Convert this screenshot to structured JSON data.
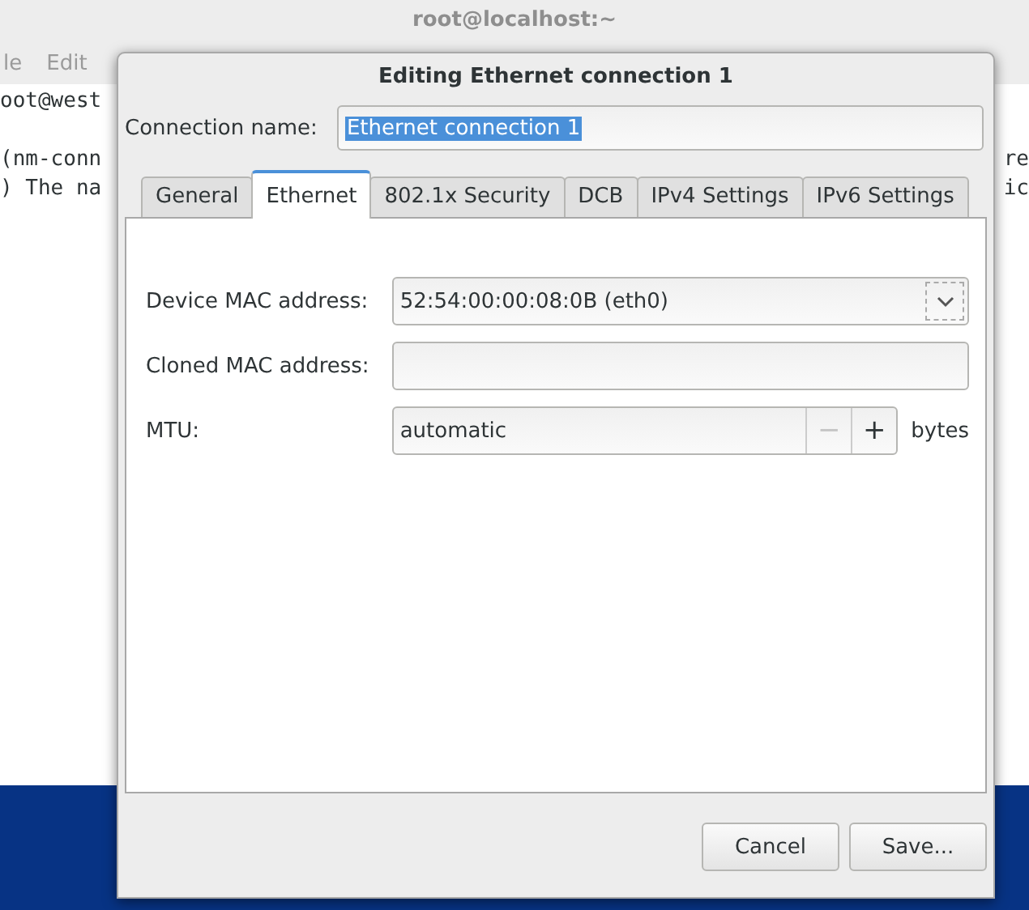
{
  "terminal": {
    "title": "root@localhost:~",
    "menu": [
      "le",
      "Edit"
    ],
    "lines": [
      {
        "left": "oot@west"
      },
      {
        "left": "(nm-conn",
        "right": "re",
        "gap_before": true
      },
      {
        "left": ") The na",
        "right": "ic"
      }
    ]
  },
  "dialog": {
    "title": "Editing Ethernet connection 1",
    "connection_name": {
      "label": "Connection name:",
      "value": "Ethernet connection 1",
      "selected_text": true
    },
    "tabs": [
      {
        "label": "General",
        "selected": false
      },
      {
        "label": "Ethernet",
        "selected": true
      },
      {
        "label": "802.1x Security",
        "selected": false
      },
      {
        "label": "DCB",
        "selected": false
      },
      {
        "label": "IPv4 Settings",
        "selected": false
      },
      {
        "label": "IPv6 Settings",
        "selected": false
      }
    ],
    "rows": [
      {
        "kind": "combo",
        "label": "Device MAC address:",
        "value": "52:54:00:00:08:0B (eth0)"
      },
      {
        "kind": "entry",
        "label": "Cloned MAC address:"
      },
      {
        "kind": "spin",
        "label": "MTU:",
        "value": "automatic",
        "unit": "bytes",
        "steppers": [
          {
            "label": "−",
            "disabled": true
          },
          {
            "label": "+",
            "disabled": false
          }
        ]
      }
    ],
    "buttons": [
      "Cancel",
      "Save..."
    ]
  }
}
